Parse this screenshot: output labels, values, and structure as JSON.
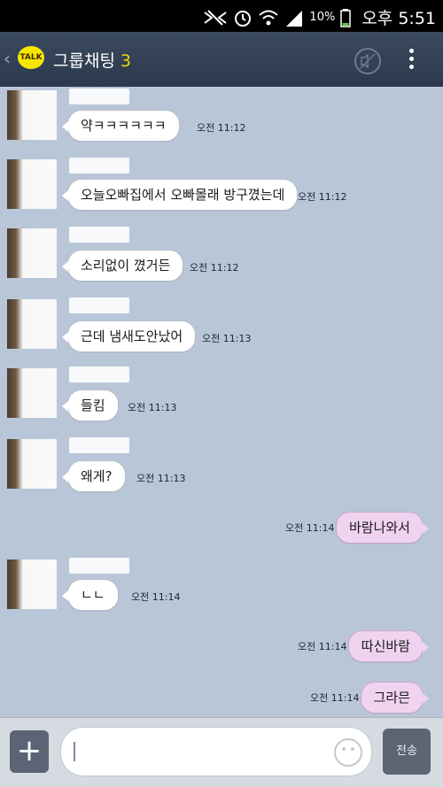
{
  "status_bar": {
    "battery": "10%",
    "time": "오후 5:51"
  },
  "header": {
    "logo": "TALK",
    "title": "그룹채팅",
    "member_count": "3",
    "back_icon": "chevron-left-icon",
    "mute_icon": "mute-icon",
    "menu_icon": "more-vertical-icon"
  },
  "messages": [
    {
      "side": "left",
      "text": "약ㅋㅋㅋㅋㅋㅋ",
      "time": "오전 11:12"
    },
    {
      "side": "left",
      "text": "오늘오빠집에서 오빠몰래 방구꼈는데",
      "time": "오전 11:12"
    },
    {
      "side": "left",
      "text": "소리없이 꼈거든",
      "time": "오전 11:12"
    },
    {
      "side": "left",
      "text": "근데 냄새도안났어",
      "time": "오전 11:13"
    },
    {
      "side": "left",
      "text": "들킴",
      "time": "오전 11:13"
    },
    {
      "side": "left",
      "text": "왜게?",
      "time": "오전 11:13"
    },
    {
      "side": "right",
      "text": "바람나와서",
      "time": "오전 11:14"
    },
    {
      "side": "left",
      "text": "ㄴㄴ",
      "time": "오전 11:14"
    },
    {
      "side": "right",
      "text": "따신바람",
      "time": "오전 11:14"
    },
    {
      "side": "right",
      "text": "그라믄",
      "time": "오전 11:14"
    }
  ],
  "input_bar": {
    "plus_label": "+",
    "send_label": "전송",
    "emoji_icon": "smiley-icon"
  },
  "colors": {
    "header_bg": "#2f3c51",
    "chat_bg": "#b8c6d8",
    "my_bubble": "#efd3ef",
    "other_bubble": "#ffffff",
    "count_color": "#f1d400"
  }
}
